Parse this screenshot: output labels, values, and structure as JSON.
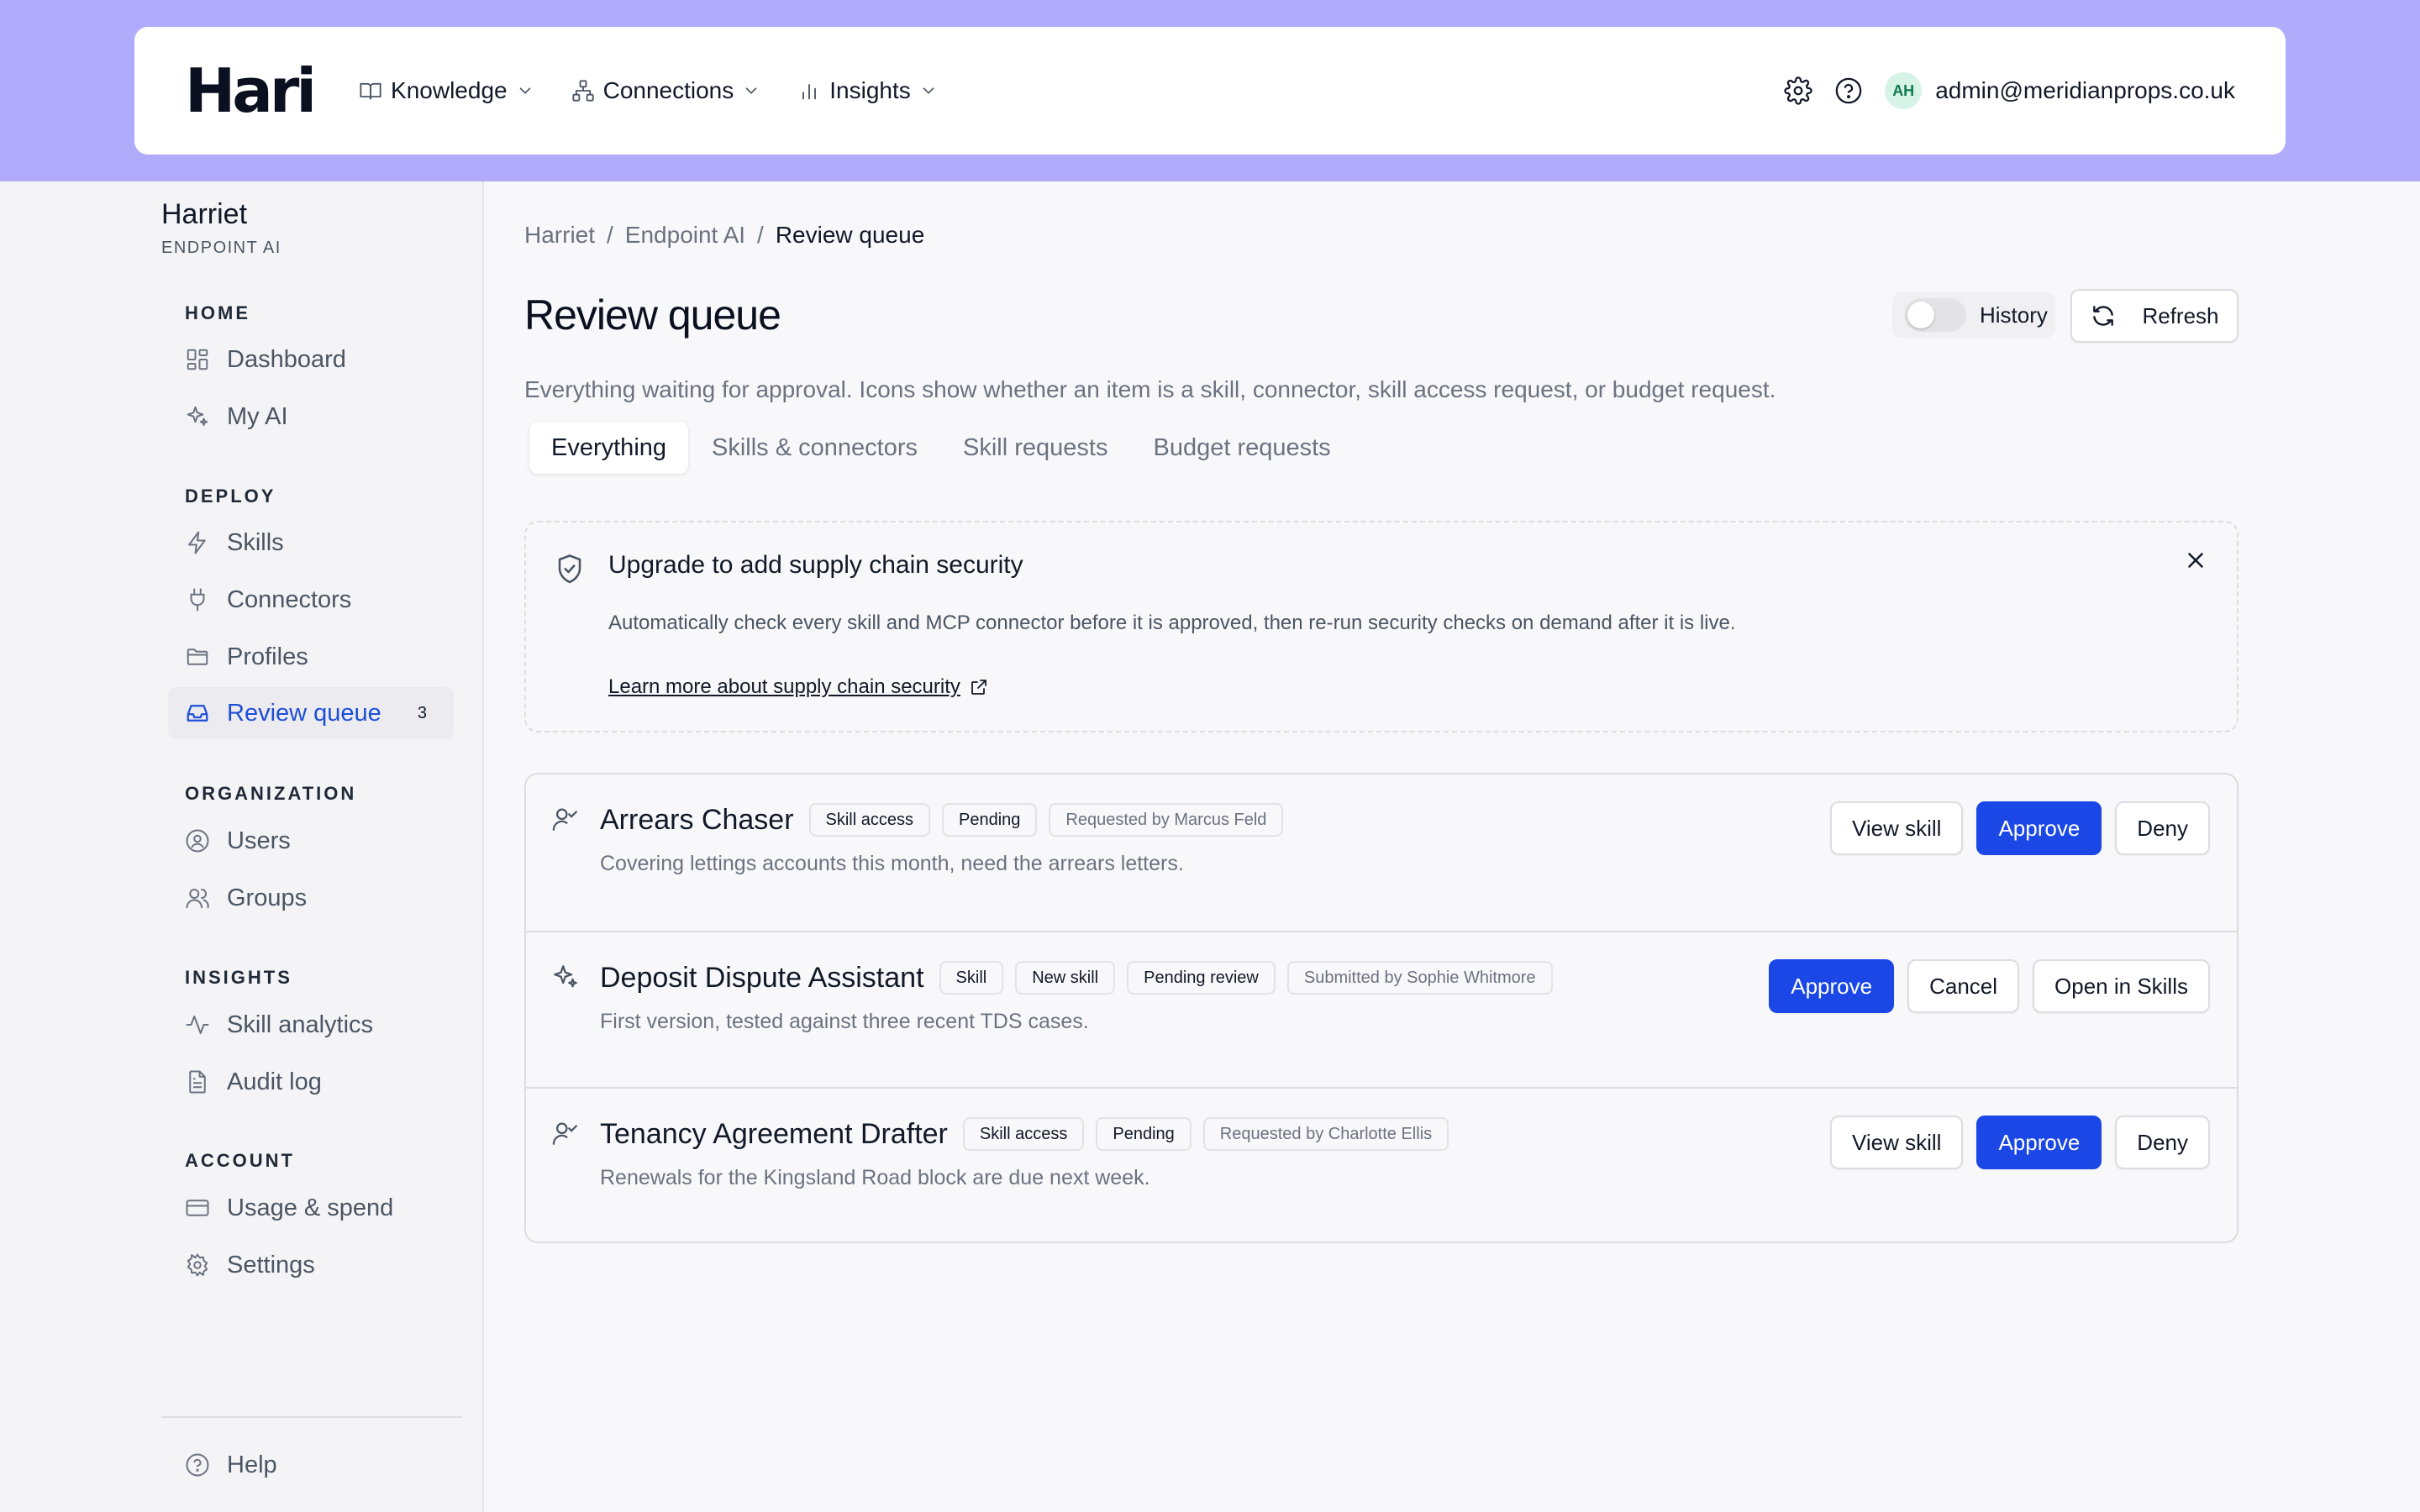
{
  "app": {
    "logo": "Hari",
    "nav": [
      {
        "label": "Knowledge",
        "icon": "book-icon"
      },
      {
        "label": "Connections",
        "icon": "network-icon"
      },
      {
        "label": "Insights",
        "icon": "bar-chart-icon"
      }
    ],
    "user": {
      "initials": "AH",
      "email": "admin@meridianprops.co.uk"
    }
  },
  "sidebar": {
    "workspace": "Harriet",
    "workspace_sub": "ENDPOINT AI",
    "sections": [
      {
        "title": "HOME",
        "items": [
          {
            "label": "Dashboard",
            "icon": "dashboard-icon"
          },
          {
            "label": "My AI",
            "icon": "sparkles-icon"
          }
        ]
      },
      {
        "title": "DEPLOY",
        "items": [
          {
            "label": "Skills",
            "icon": "lightning-icon"
          },
          {
            "label": "Connectors",
            "icon": "plug-icon"
          },
          {
            "label": "Profiles",
            "icon": "folder-icon"
          },
          {
            "label": "Review queue",
            "icon": "inbox-icon",
            "badge": "3",
            "active": true
          }
        ]
      },
      {
        "title": "ORGANIZATION",
        "items": [
          {
            "label": "Users",
            "icon": "user-circle-icon"
          },
          {
            "label": "Groups",
            "icon": "users-icon"
          }
        ]
      },
      {
        "title": "INSIGHTS",
        "items": [
          {
            "label": "Skill analytics",
            "icon": "activity-icon"
          },
          {
            "label": "Audit log",
            "icon": "document-icon"
          }
        ]
      },
      {
        "title": "ACCOUNT",
        "items": [
          {
            "label": "Usage & spend",
            "icon": "credit-card-icon"
          },
          {
            "label": "Settings",
            "icon": "gear-icon"
          }
        ]
      }
    ],
    "help": "Help"
  },
  "main": {
    "breadcrumb": [
      "Harriet",
      "Endpoint AI",
      "Review queue"
    ],
    "title": "Review queue",
    "history_label": "History",
    "history_on": false,
    "refresh_label": "Refresh",
    "subtitle": "Everything waiting for approval. Icons show whether an item is a skill, connector, skill access request, or budget request.",
    "tabs": [
      "Everything",
      "Skills & connectors",
      "Skill requests",
      "Budget requests"
    ],
    "active_tab": "Everything",
    "banner": {
      "title": "Upgrade to add supply chain security",
      "text": "Automatically check every skill and MCP connector before it is approved, then re-run security checks on demand after it is live.",
      "link": "Learn more about supply chain security"
    },
    "queue": [
      {
        "title": "Arrears Chaser",
        "icon": "user-check-icon",
        "chips": [
          "Skill access",
          "Pending",
          "Requested by Marcus Feld"
        ],
        "description": "Covering lettings accounts this month, need the arrears letters.",
        "actions": [
          "View skill",
          "Approve",
          "Deny"
        ]
      },
      {
        "title": "Deposit Dispute Assistant",
        "icon": "sparkles-icon",
        "chips": [
          "Skill",
          "New skill",
          "Pending review",
          "Submitted by Sophie Whitmore"
        ],
        "description": "First version, tested against three recent TDS cases.",
        "actions": [
          "Approve",
          "Cancel",
          "Open in Skills"
        ]
      },
      {
        "title": "Tenancy Agreement Drafter",
        "icon": "user-check-icon",
        "chips": [
          "Skill access",
          "Pending",
          "Requested by Charlotte Ellis"
        ],
        "description": "Renewals for the Kingsland Road block are due next week.",
        "actions": [
          "View skill",
          "Approve",
          "Deny"
        ]
      }
    ]
  },
  "colors": {
    "header_band": "#b0abfb",
    "accent": "#1a47e6",
    "active_nav": "#1d4ed8"
  }
}
